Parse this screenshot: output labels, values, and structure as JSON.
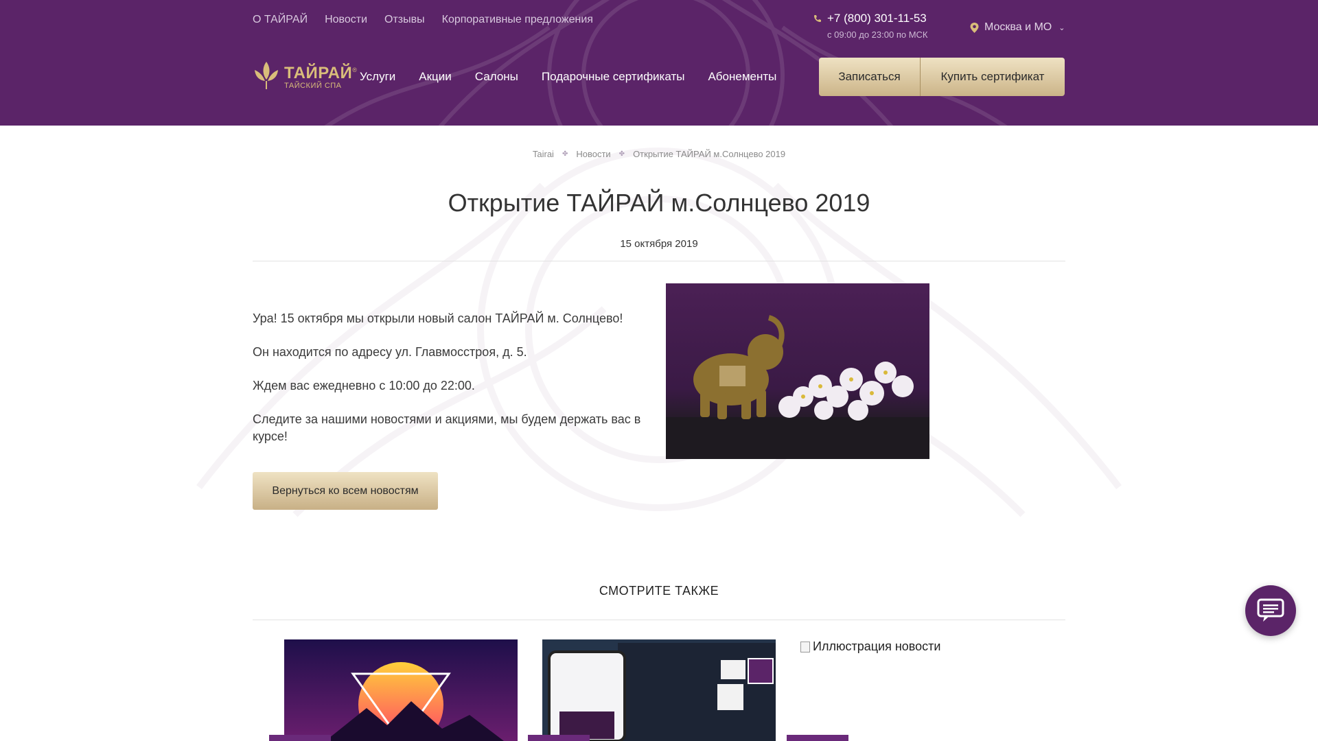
{
  "header": {
    "top_links": [
      "О ТАЙРАЙ",
      "Новости",
      "Отзывы",
      "Корпоративные предложения"
    ],
    "phone": "+7 (800) 301-11-53",
    "hours": "с 09:00 до 23:00 по МСК",
    "city": "Москва и МО",
    "logo": {
      "name": "ТАЙРАЙ",
      "reg": "®",
      "subtitle": "ТАЙСКИЙ СПА"
    },
    "nav": [
      "Услуги",
      "Акции",
      "Салоны",
      "Подарочные сертификаты",
      "Абонементы"
    ],
    "book_label": "Записаться",
    "cert_label": "Купить сертификат"
  },
  "breadcrumb": [
    "Tairai",
    "Новости",
    "Открытие ТАЙРАЙ м.Солнцево 2019"
  ],
  "article": {
    "title": "Открытие ТАЙРАЙ м.Солнцево 2019",
    "date": "15 октября 2019",
    "paragraphs": [
      "Ура! 15 октября мы открыли новый салон ТАЙРАЙ м. Солнцево!",
      "Он находится по адресу ул. Главмосстроя, д. 5.",
      "Ждем вас ежедневно с 10:00 до 22:00.",
      "Следите за нашими новостями и акциями, мы будем держать вас в курсе!"
    ],
    "back_label": "Вернуться ко всем новостям"
  },
  "see_also": {
    "heading": "СМОТРИТЕ ТАКЖЕ",
    "broken_image_alt": "Иллюстрация новости"
  },
  "colors": {
    "brand_purple": "#5b2468",
    "gold": "#d9bd7a"
  },
  "icons": [
    "phone-icon",
    "location-pin-icon",
    "chevron-down-icon",
    "lotus-logo-icon",
    "chat-icon"
  ]
}
